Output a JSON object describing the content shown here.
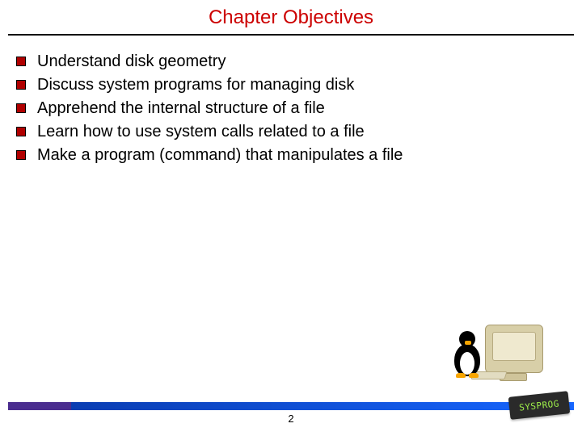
{
  "title": "Chapter Objectives",
  "bullets": [
    "Understand disk geometry",
    "Discuss system programs for managing disk",
    "Apprehend the internal structure of a file",
    "Learn how to use system calls related to a file",
    "Make a program (command) that manipulates a file"
  ],
  "page_number": "2",
  "logo_text": "SYSPROG"
}
